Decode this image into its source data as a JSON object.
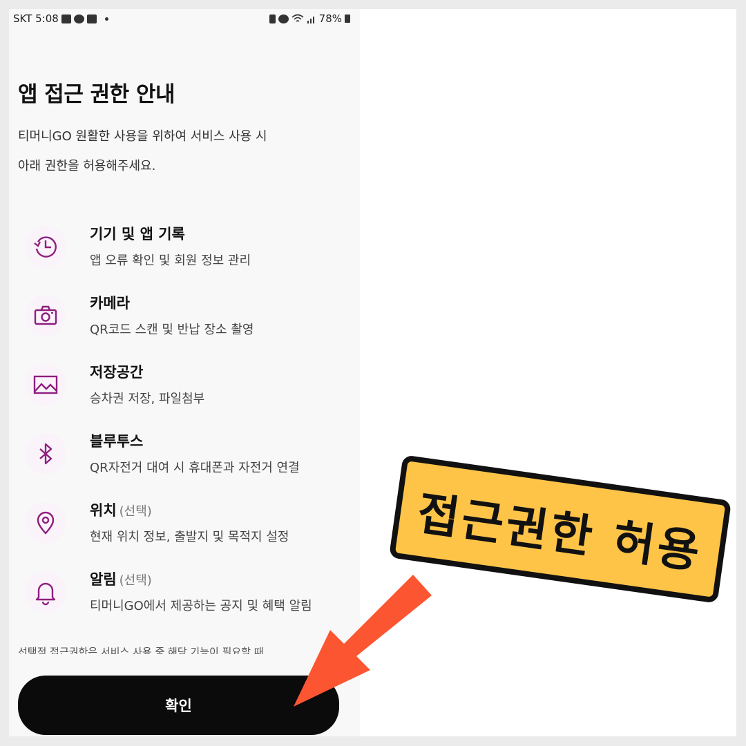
{
  "status_bar": {
    "carrier_time": "SKT 5:08",
    "battery": "78%",
    "icons": [
      "kakao-icon",
      "talk-icon",
      "gallery-icon",
      "battery-saver-icon",
      "alarm-icon",
      "wifi-icon",
      "signal-icon"
    ]
  },
  "page": {
    "title": "앱 접근 권한 안내",
    "description_line1": "티머니GO 원활한 사용을 위하여 서비스 사용 시",
    "description_line2": "아래 권한을 허용해주세요."
  },
  "permissions": [
    {
      "icon": "history-icon",
      "title": "기기 및 앱 기록",
      "optional": "",
      "description": "앱 오류 확인 및 회원 정보 관리"
    },
    {
      "icon": "camera-icon",
      "title": "카메라",
      "optional": "",
      "description": "QR코드 스캔 및 반납 장소 촬영"
    },
    {
      "icon": "image-icon",
      "title": "저장공간",
      "optional": "",
      "description": "승차권 저장, 파일첨부"
    },
    {
      "icon": "bluetooth-icon",
      "title": "블루투스",
      "optional": "",
      "description": "QR자전거 대여 시 휴대폰과 자전거 연결"
    },
    {
      "icon": "location-pin-icon",
      "title": "위치",
      "optional": "(선택)",
      "description": "현재 위치 정보, 출발지 및 목적지 설정"
    },
    {
      "icon": "bell-icon",
      "title": "알림",
      "optional": "(선택)",
      "description": "티머니GO에서 제공하는 공지 및 혜택 알림"
    }
  ],
  "note": "선택적 접근권한은 서비스 사용 중 해당 기능이 필요할 때",
  "confirm_button": "확인",
  "overlay": {
    "sticker_text": "접근권한 허용",
    "colors": {
      "sticker": "#fec448",
      "arrow": "#fc5531",
      "accent": "#8e1f7f"
    }
  }
}
